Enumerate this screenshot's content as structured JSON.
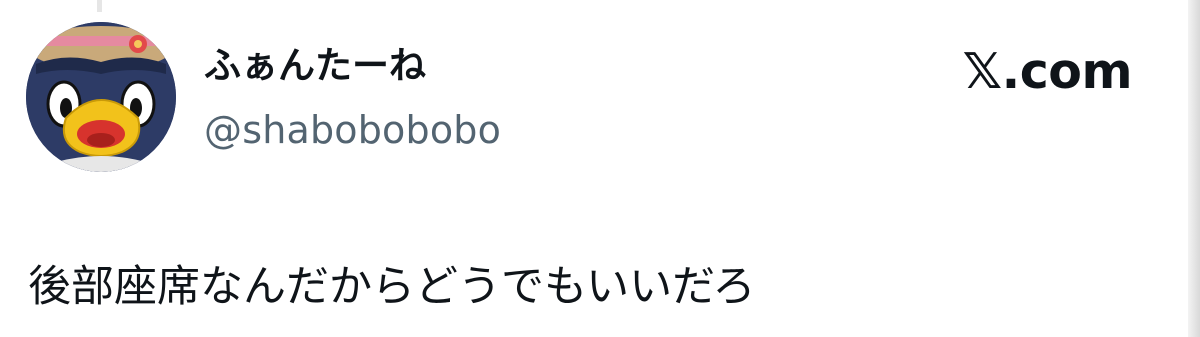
{
  "tweet": {
    "author": {
      "display_name": "ふぁんたーね",
      "handle": "@shabobobobo",
      "avatar": "mascot-bird-avatar"
    },
    "source": "𝕏.com",
    "text": "後部座席なんだからどうでもいいだろ"
  },
  "colors": {
    "name": "#0f1419",
    "handle": "#536471",
    "text": "#0f1419",
    "background": "#ffffff"
  }
}
